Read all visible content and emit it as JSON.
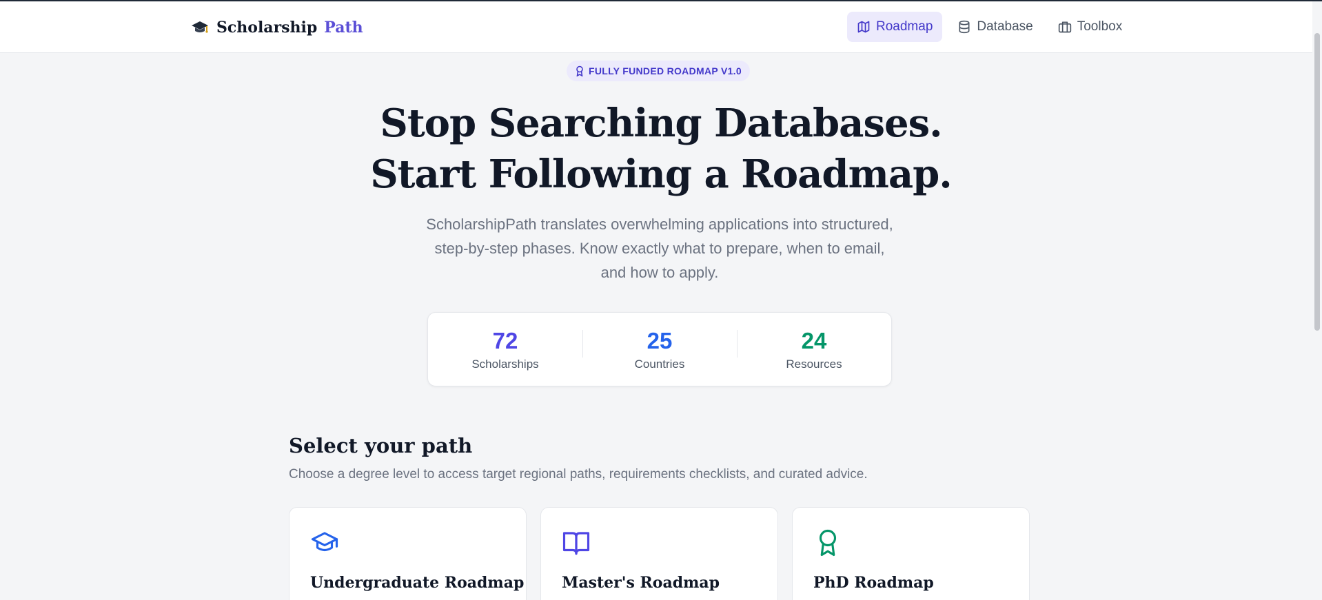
{
  "brand": {
    "name": "Scholarship",
    "accent": "Path",
    "icon": "graduation-cap-icon"
  },
  "nav": {
    "items": [
      {
        "label": "Roadmap",
        "icon": "map-icon",
        "active": true
      },
      {
        "label": "Database",
        "icon": "database-icon",
        "active": false
      },
      {
        "label": "Toolbox",
        "icon": "briefcase-icon",
        "active": false
      }
    ]
  },
  "hero": {
    "badge": "FULLY FUNDED ROADMAP V1.0",
    "title_line1": "Stop Searching Databases.",
    "title_line2": "Start Following a Roadmap.",
    "subtitle_line1": "ScholarshipPath translates overwhelming applications into structured,",
    "subtitle_line2": "step-by-step phases. Know exactly what to prepare, when to email,",
    "subtitle_line3": "and how to apply."
  },
  "stats": [
    {
      "value": "72",
      "label": "Scholarships",
      "color": "#4f46e5"
    },
    {
      "value": "25",
      "label": "Countries",
      "color": "#2563eb"
    },
    {
      "value": "24",
      "label": "Resources",
      "color": "#059669"
    }
  ],
  "paths": {
    "title": "Select your path",
    "subtitle": "Choose a degree level to access target regional paths, requirements checklists, and curated advice.",
    "cards": [
      {
        "title": "Undergraduate Roadmap",
        "icon": "graduation-cap-icon",
        "color": "#2563eb"
      },
      {
        "title": "Master's Roadmap",
        "icon": "open-book-icon",
        "color": "#4f46e5"
      },
      {
        "title": "PhD Roadmap",
        "icon": "award-ribbon-icon",
        "color": "#059669"
      }
    ]
  },
  "colors": {
    "accent": "#5b4fd6",
    "active_nav_bg": "#eceafc",
    "page_bg": "#f4f5f7"
  }
}
